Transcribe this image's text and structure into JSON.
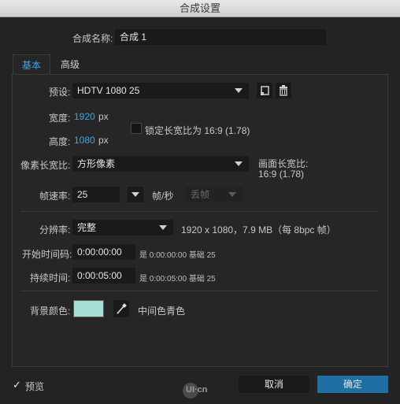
{
  "window": {
    "title": "合成设置"
  },
  "comp_name": {
    "label": "合成名称:",
    "value": "合成 1"
  },
  "tabs": [
    {
      "label": "基本"
    },
    {
      "label": "高级"
    }
  ],
  "preset": {
    "label": "预设:",
    "value": "HDTV 1080 25"
  },
  "width": {
    "label": "宽度:",
    "value": "1920",
    "unit": "px"
  },
  "height": {
    "label": "高度:",
    "value": "1080",
    "unit": "px"
  },
  "lock_aspect": {
    "label": "锁定长宽比为 16:9 (1.78)",
    "checked": false
  },
  "pixel_aspect": {
    "label": "像素长宽比:",
    "value": "方形像素"
  },
  "frame_aspect": {
    "label": "画面长宽比:",
    "value": "16:9 (1.78)"
  },
  "frame_rate": {
    "label": "帧速率:",
    "value": "25",
    "unit": "帧/秒",
    "drop_frame": "丢帧"
  },
  "resolution": {
    "label": "分辨率:",
    "value": "完整",
    "info": "1920 x 1080，7.9 MB（每 8bpc 帧）"
  },
  "start_timecode": {
    "label": "开始时间码:",
    "value": "0:00:00:00",
    "info": "是 0:00:00:00 基础 25"
  },
  "duration": {
    "label": "持续时间:",
    "value": "0:00:05:00",
    "info": "是 0:00:05:00 基础 25"
  },
  "bg_color": {
    "label": "背景颜色:",
    "swatch": "#a6ddd6",
    "name": "中间色青色"
  },
  "footer": {
    "preview_label": "预览",
    "preview_checked": true,
    "watermark": "UI·cn",
    "cancel_label": "取消",
    "ok_label": "确定"
  },
  "colors": {
    "accent": "#3ea6e6",
    "ok_button": "#1f6fa3",
    "background": "#232323"
  }
}
